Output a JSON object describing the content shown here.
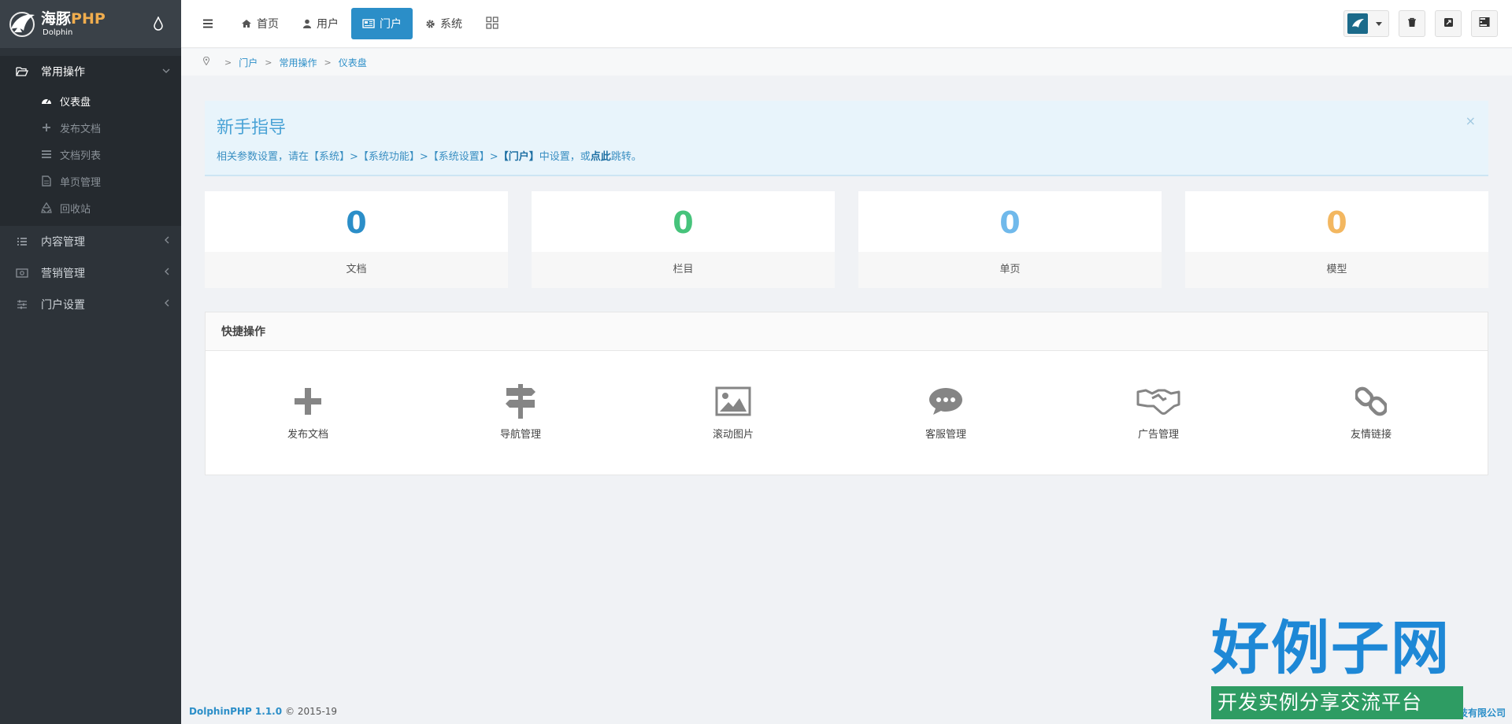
{
  "logo": {
    "name_cn": "海豚",
    "name_php": "PHP",
    "name_en": "Dolphin"
  },
  "sidebar": {
    "groups": [
      {
        "label": "常用操作",
        "icon": "folder-open-icon",
        "expanded": true,
        "items": [
          {
            "label": "仪表盘",
            "icon": "dashboard-icon",
            "active": true
          },
          {
            "label": "发布文档",
            "icon": "plus-icon"
          },
          {
            "label": "文档列表",
            "icon": "list-icon"
          },
          {
            "label": "单页管理",
            "icon": "file-icon"
          },
          {
            "label": "回收站",
            "icon": "recycle-icon"
          }
        ]
      },
      {
        "label": "内容管理",
        "icon": "list-icon"
      },
      {
        "label": "营销管理",
        "icon": "money-icon"
      },
      {
        "label": "门户设置",
        "icon": "sliders-icon"
      }
    ]
  },
  "topbar": {
    "tabs": [
      {
        "label": "首页",
        "icon": "home-icon"
      },
      {
        "label": "用户",
        "icon": "user-icon"
      },
      {
        "label": "门户",
        "icon": "newspaper-icon",
        "active": true
      },
      {
        "label": "系统",
        "icon": "gear-icon"
      }
    ]
  },
  "breadcrumb": [
    "门户",
    "常用操作",
    "仪表盘"
  ],
  "guide": {
    "title": "新手指导",
    "text_before": "相关参数设置，请在【系统】>【系统功能】>【系统设置】>",
    "text_bold": "【门户】",
    "text_mid": "中设置，或",
    "link": "点此",
    "text_after": "跳转。",
    "close": "×"
  },
  "stats": [
    {
      "value": "0",
      "label": "文档",
      "color": "#2b8ec8"
    },
    {
      "value": "0",
      "label": "栏目",
      "color": "#46c37b"
    },
    {
      "value": "0",
      "label": "单页",
      "color": "#70b9eb"
    },
    {
      "value": "0",
      "label": "模型",
      "color": "#f3b760"
    }
  ],
  "quick": {
    "title": "快捷操作",
    "items": [
      {
        "label": "发布文档",
        "icon": "plus-icon"
      },
      {
        "label": "导航管理",
        "icon": "signpost-icon"
      },
      {
        "label": "滚动图片",
        "icon": "image-icon"
      },
      {
        "label": "客服管理",
        "icon": "chat-icon"
      },
      {
        "label": "广告管理",
        "icon": "handshake-icon"
      },
      {
        "label": "友情链接",
        "icon": "link-icon"
      }
    ]
  },
  "footer": {
    "brand": "DolphinPHP 1.1.0",
    "copyright": "© 2015-19",
    "company": "技有限公司"
  },
  "watermark": {
    "big": "好例子网",
    "small": "开发实例分享交流平台"
  }
}
